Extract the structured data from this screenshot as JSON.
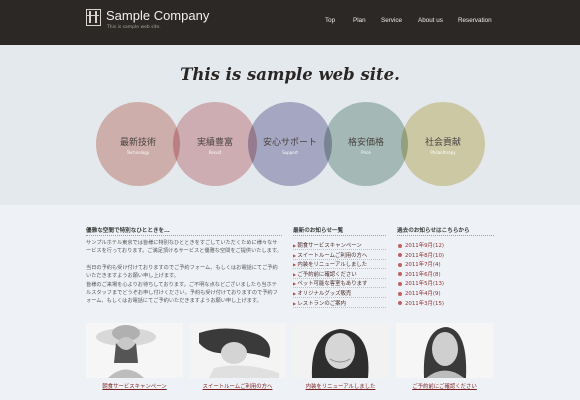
{
  "header": {
    "company": "Sample Company",
    "tagline": "This is sample web site.",
    "logo_icon": "film-strip-icon",
    "nav": [
      "Top",
      "Plan",
      "Service",
      "About us",
      "Reservation"
    ]
  },
  "hero": {
    "title": "This is sample web site.",
    "circles": [
      {
        "label": "最新技術",
        "sub": "Technology",
        "color": "#e6bfb6"
      },
      {
        "label": "実績豊富",
        "sub": "Result",
        "color": "#e6bcbf"
      },
      {
        "label": "安心サポート",
        "sub": "Support",
        "color": "#b9b6cf"
      },
      {
        "label": "格安価格",
        "sub": "Price",
        "color": "#b8cbc2"
      },
      {
        "label": "社会貢献",
        "sub": "Philanthropy",
        "color": "#e5dbb0"
      }
    ]
  },
  "intro": {
    "title": "優雅な空間で特別なひとときを…",
    "paragraphs": [
      "サンプルホテル東京では皆様に特別なひとときをすごしていただくために様々なサービスを行っております。ご満足頂けるサービスと優雅な空間をご提供いたします。",
      "当日の予約も受け付けておりますのでご予約フォーム、もしくはお電話にてご予約いただきますようお願い申し上げます。",
      "皆様のご来場を心よりお待ちしております。ご不明な点などございましたら当ホテルスタッフまでどうぞお申し付けください。予約も受け付けておりますので予約フォーム、もしくはお電話にてご予約いただきますようお願い申し上げます。"
    ]
  },
  "news": {
    "title": "最新のお知らせ一覧",
    "items": [
      "朝食サービスキャンペーン",
      "スイートルームご利用の方へ",
      "内装をリニューアルしました",
      "ご予約前に確認ください",
      "ペット可能な客室もあります",
      "オリジナルグッズ販売",
      "レストランのご案内"
    ]
  },
  "archive": {
    "title": "過去のお知らせはこちらから",
    "items": [
      "2011年9月(12)",
      "2011年8月(10)",
      "2011年7月(4)",
      "2011年6月(8)",
      "2011年5月(13)",
      "2011年4月(9)",
      "2011年3月(15)"
    ]
  },
  "photos": [
    {
      "caption": "朝食サービスキャンペーン"
    },
    {
      "caption": "スイートルームご利用の方へ"
    },
    {
      "caption": "内装をリニューアルしました"
    },
    {
      "caption": "ご予約前にご確認ください"
    }
  ]
}
